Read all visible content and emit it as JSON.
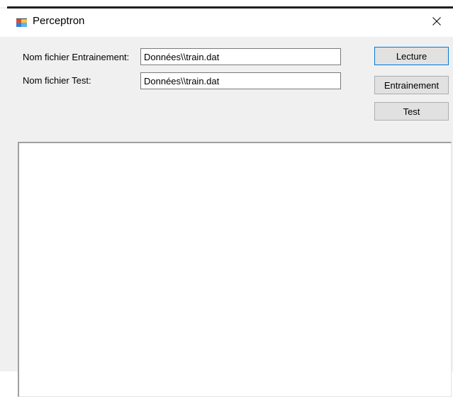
{
  "window": {
    "title": "Perceptron",
    "icon": "app-window-icon",
    "close_icon": "close-icon"
  },
  "form": {
    "train_label": "Nom fichier Entrainement:",
    "train_value": "Données\\\\train.dat",
    "test_label": "Nom fichier Test:",
    "test_value": "Données\\\\train.dat"
  },
  "buttons": {
    "read_label": "Lecture",
    "train_label": "Entrainement",
    "test_label": "Test"
  },
  "output": {
    "text": ""
  },
  "colors": {
    "background": "#f0f0f0",
    "titlebar": "#ffffff",
    "button_face": "#e1e1e1",
    "focus_border": "#0078d7"
  }
}
